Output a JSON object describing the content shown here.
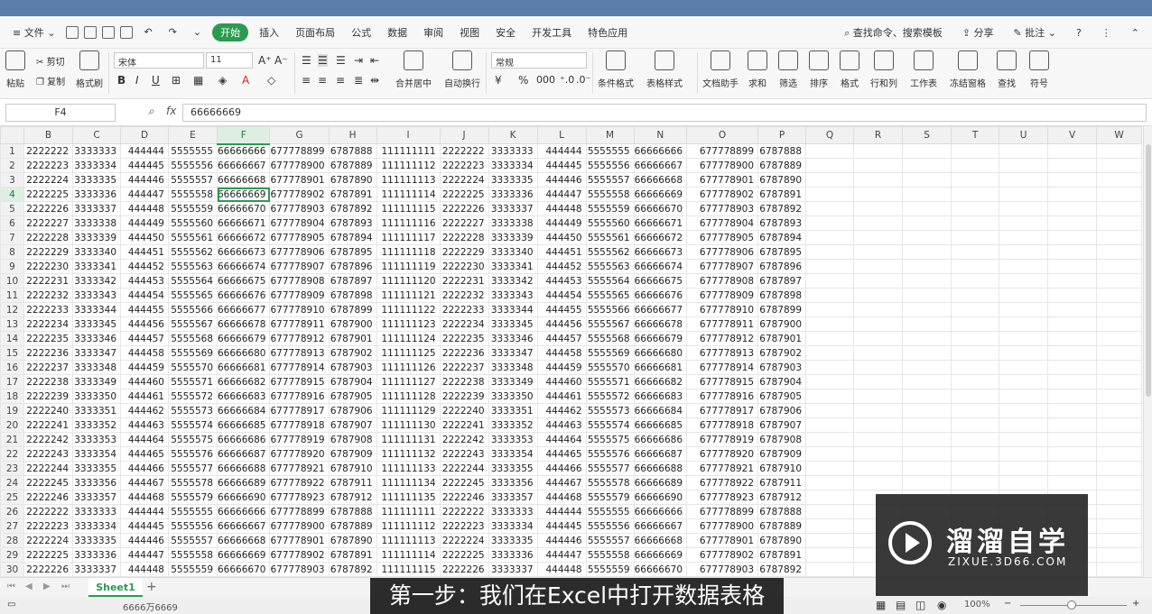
{
  "menu": {
    "file": "文件",
    "tabs": [
      "开始",
      "插入",
      "页面布局",
      "公式",
      "数据",
      "审阅",
      "视图",
      "安全",
      "开发工具",
      "特色应用"
    ],
    "search": "查找命令、搜索模板",
    "share": "分享",
    "comment": "批注"
  },
  "ribbon": {
    "paste": "粘贴",
    "cut": "剪切",
    "copy": "复制",
    "format_painter": "格式刷",
    "font_name": "宋体",
    "font_size": "11",
    "merge_center": "合并居中",
    "wrap_text": "自动换行",
    "number_format": "常规",
    "conditional_format": "条件格式",
    "table_style": "表格样式",
    "doc_helper": "文档助手",
    "sum": "求和",
    "filter": "筛选",
    "sort": "排序",
    "format": "格式",
    "rows_cols": "行和列",
    "worksheet": "工作表",
    "freeze": "冻结窗格",
    "find": "查找",
    "symbol": "符号"
  },
  "formula_bar": {
    "cell_ref": "F4",
    "fx": "fx",
    "value": "66666669"
  },
  "sheet": {
    "columns": [
      "B",
      "C",
      "D",
      "E",
      "F",
      "G",
      "H",
      "I",
      "J",
      "K",
      "L",
      "M",
      "N",
      "O",
      "P",
      "Q",
      "R",
      "S",
      "T",
      "U",
      "V",
      "W"
    ],
    "selected_col": "F",
    "selected_row": 4,
    "rows": [
      [
        "2222222",
        "3333333",
        "444444",
        "5555555",
        "66666666",
        "677778899",
        "6787888",
        "111111111",
        "2222222",
        "3333333",
        "444444",
        "5555555",
        "66666666",
        "677778899",
        "6787888"
      ],
      [
        "2222223",
        "3333334",
        "444445",
        "5555556",
        "66666667",
        "677778900",
        "6787889",
        "111111112",
        "2222223",
        "3333334",
        "444445",
        "5555556",
        "66666667",
        "677778900",
        "6787889"
      ],
      [
        "2222224",
        "3333335",
        "444446",
        "5555557",
        "66666668",
        "677778901",
        "6787890",
        "111111113",
        "2222224",
        "3333335",
        "444446",
        "5555557",
        "66666668",
        "677778901",
        "6787890"
      ],
      [
        "2222225",
        "3333336",
        "444447",
        "5555558",
        "66666669",
        "677778902",
        "6787891",
        "111111114",
        "2222225",
        "3333336",
        "444447",
        "5555558",
        "66666669",
        "677778902",
        "6787891"
      ],
      [
        "2222226",
        "3333337",
        "444448",
        "5555559",
        "66666670",
        "677778903",
        "6787892",
        "111111115",
        "2222226",
        "3333337",
        "444448",
        "5555559",
        "66666670",
        "677778903",
        "6787892"
      ],
      [
        "2222227",
        "3333338",
        "444449",
        "5555560",
        "66666671",
        "677778904",
        "6787893",
        "111111116",
        "2222227",
        "3333338",
        "444449",
        "5555560",
        "66666671",
        "677778904",
        "6787893"
      ],
      [
        "2222228",
        "3333339",
        "444450",
        "5555561",
        "66666672",
        "677778905",
        "6787894",
        "111111117",
        "2222228",
        "3333339",
        "444450",
        "5555561",
        "66666672",
        "677778905",
        "6787894"
      ],
      [
        "2222229",
        "3333340",
        "444451",
        "5555562",
        "66666673",
        "677778906",
        "6787895",
        "111111118",
        "2222229",
        "3333340",
        "444451",
        "5555562",
        "66666673",
        "677778906",
        "6787895"
      ],
      [
        "2222230",
        "3333341",
        "444452",
        "5555563",
        "66666674",
        "677778907",
        "6787896",
        "111111119",
        "2222230",
        "3333341",
        "444452",
        "5555563",
        "66666674",
        "677778907",
        "6787896"
      ],
      [
        "2222231",
        "3333342",
        "444453",
        "5555564",
        "66666675",
        "677778908",
        "6787897",
        "111111120",
        "2222231",
        "3333342",
        "444453",
        "5555564",
        "66666675",
        "677778908",
        "6787897"
      ],
      [
        "2222232",
        "3333343",
        "444454",
        "5555565",
        "66666676",
        "677778909",
        "6787898",
        "111111121",
        "2222232",
        "3333343",
        "444454",
        "5555565",
        "66666676",
        "677778909",
        "6787898"
      ],
      [
        "2222233",
        "3333344",
        "444455",
        "5555566",
        "66666677",
        "677778910",
        "6787899",
        "111111122",
        "2222233",
        "3333344",
        "444455",
        "5555566",
        "66666677",
        "677778910",
        "6787899"
      ],
      [
        "2222234",
        "3333345",
        "444456",
        "5555567",
        "66666678",
        "677778911",
        "6787900",
        "111111123",
        "2222234",
        "3333345",
        "444456",
        "5555567",
        "66666678",
        "677778911",
        "6787900"
      ],
      [
        "2222235",
        "3333346",
        "444457",
        "5555568",
        "66666679",
        "677778912",
        "6787901",
        "111111124",
        "2222235",
        "3333346",
        "444457",
        "5555568",
        "66666679",
        "677778912",
        "6787901"
      ],
      [
        "2222236",
        "3333347",
        "444458",
        "5555569",
        "66666680",
        "677778913",
        "6787902",
        "111111125",
        "2222236",
        "3333347",
        "444458",
        "5555569",
        "66666680",
        "677778913",
        "6787902"
      ],
      [
        "2222237",
        "3333348",
        "444459",
        "5555570",
        "66666681",
        "677778914",
        "6787903",
        "111111126",
        "2222237",
        "3333348",
        "444459",
        "5555570",
        "66666681",
        "677778914",
        "6787903"
      ],
      [
        "2222238",
        "3333349",
        "444460",
        "5555571",
        "66666682",
        "677778915",
        "6787904",
        "111111127",
        "2222238",
        "3333349",
        "444460",
        "5555571",
        "66666682",
        "677778915",
        "6787904"
      ],
      [
        "2222239",
        "3333350",
        "444461",
        "5555572",
        "66666683",
        "677778916",
        "6787905",
        "111111128",
        "2222239",
        "3333350",
        "444461",
        "5555572",
        "66666683",
        "677778916",
        "6787905"
      ],
      [
        "2222240",
        "3333351",
        "444462",
        "5555573",
        "66666684",
        "677778917",
        "6787906",
        "111111129",
        "2222240",
        "3333351",
        "444462",
        "5555573",
        "66666684",
        "677778917",
        "6787906"
      ],
      [
        "2222241",
        "3333352",
        "444463",
        "5555574",
        "66666685",
        "677778918",
        "6787907",
        "111111130",
        "2222241",
        "3333352",
        "444463",
        "5555574",
        "66666685",
        "677778918",
        "6787907"
      ],
      [
        "2222242",
        "3333353",
        "444464",
        "5555575",
        "66666686",
        "677778919",
        "6787908",
        "111111131",
        "2222242",
        "3333353",
        "444464",
        "5555575",
        "66666686",
        "677778919",
        "6787908"
      ],
      [
        "2222243",
        "3333354",
        "444465",
        "5555576",
        "66666687",
        "677778920",
        "6787909",
        "111111132",
        "2222243",
        "3333354",
        "444465",
        "5555576",
        "66666687",
        "677778920",
        "6787909"
      ],
      [
        "2222244",
        "3333355",
        "444466",
        "5555577",
        "66666688",
        "677778921",
        "6787910",
        "111111133",
        "2222244",
        "3333355",
        "444466",
        "5555577",
        "66666688",
        "677778921",
        "6787910"
      ],
      [
        "2222245",
        "3333356",
        "444467",
        "5555578",
        "66666689",
        "677778922",
        "6787911",
        "111111134",
        "2222245",
        "3333356",
        "444467",
        "5555578",
        "66666689",
        "677778922",
        "6787911"
      ],
      [
        "2222246",
        "3333357",
        "444468",
        "5555579",
        "66666690",
        "677778923",
        "6787912",
        "111111135",
        "2222246",
        "3333357",
        "444468",
        "5555579",
        "66666690",
        "677778923",
        "6787912"
      ],
      [
        "2222222",
        "3333333",
        "444444",
        "5555555",
        "66666666",
        "677778899",
        "6787888",
        "111111111",
        "2222222",
        "3333333",
        "444444",
        "5555555",
        "66666666",
        "677778899",
        "6787888"
      ],
      [
        "2222223",
        "3333334",
        "444445",
        "5555556",
        "66666667",
        "677778900",
        "6787889",
        "111111112",
        "2222223",
        "3333334",
        "444445",
        "5555556",
        "66666667",
        "677778900",
        "6787889"
      ],
      [
        "2222224",
        "3333335",
        "444446",
        "5555557",
        "66666668",
        "677778901",
        "6787890",
        "111111113",
        "2222224",
        "3333335",
        "444446",
        "5555557",
        "66666668",
        "677778901",
        "6787890"
      ],
      [
        "2222225",
        "3333336",
        "444447",
        "5555558",
        "66666669",
        "677778902",
        "6787891",
        "111111114",
        "2222225",
        "3333336",
        "444447",
        "5555558",
        "66666669",
        "677778902",
        "6787891"
      ],
      [
        "2222226",
        "3333337",
        "444448",
        "5555559",
        "66666670",
        "677778903",
        "6787892",
        "111111115",
        "2222226",
        "3333337",
        "444448",
        "5555559",
        "66666670",
        "677778903",
        "6787892"
      ]
    ],
    "tab": "Sheet1",
    "add_tab": "+"
  },
  "status": {
    "sum": "6666万6669",
    "zoom": "100%",
    "zoom_value": 100
  },
  "caption": "第一步：我们在Excel中打开数据表格",
  "watermark": {
    "title": "溜溜自学",
    "url": "ZIXUE.3D66.COM"
  },
  "colors": {
    "accent": "#2b9b4f",
    "title_strip": "#5a7ea8"
  }
}
